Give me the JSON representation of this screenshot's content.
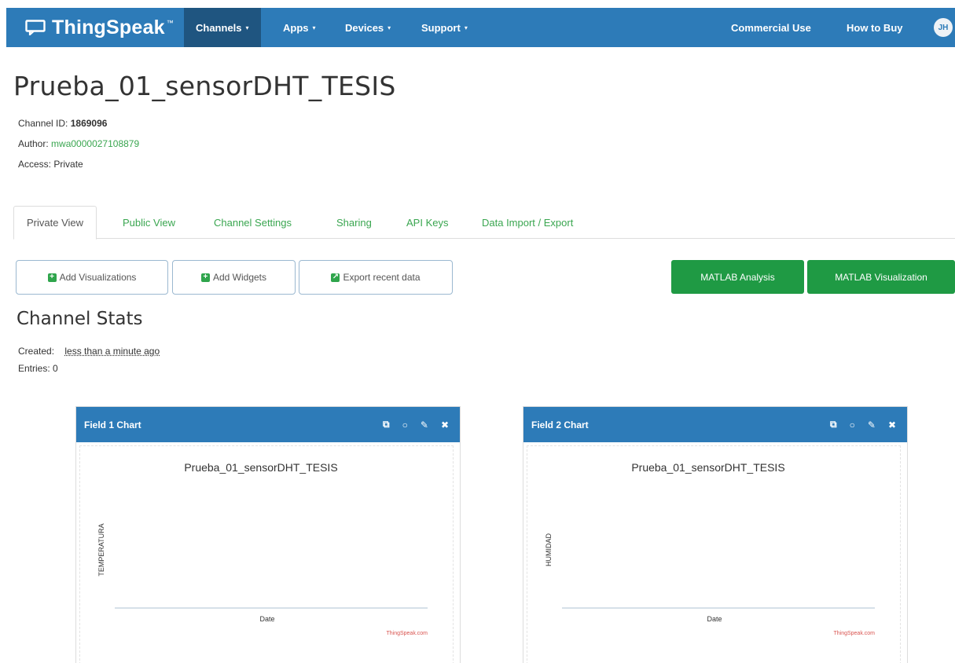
{
  "nav": {
    "brand": "ThingSpeak",
    "trademark": "™",
    "items": [
      {
        "label": "Channels",
        "caret": "▾"
      },
      {
        "label": "Apps",
        "caret": "▾"
      },
      {
        "label": "Devices",
        "caret": "▾"
      },
      {
        "label": "Support",
        "caret": "▾"
      }
    ],
    "right_items": [
      "Commercial Use",
      "How to Buy"
    ],
    "avatar_initials": "JH"
  },
  "channel": {
    "title": "Prueba_01_sensorDHT_TESIS",
    "id_label": "Channel ID:",
    "id_value": "1869096",
    "author_label": "Author:",
    "author_value": "mwa0000027108879",
    "access_label": "Access:",
    "access_value": "Private"
  },
  "tabs": [
    "Private View",
    "Public View",
    "Channel Settings",
    "Sharing",
    "API Keys",
    "Data Import / Export"
  ],
  "buttons": {
    "add_visualizations": "Add Visualizations",
    "add_widgets": "Add Widgets",
    "export_recent": "Export recent data",
    "matlab_analysis": "MATLAB Analysis",
    "matlab_visualization": "MATLAB Visualization"
  },
  "stats": {
    "title": "Channel Stats",
    "created_label": "Created:",
    "created_value": "less than a minute ago",
    "entries_label": "Entries:",
    "entries_value": "0"
  },
  "colors": {
    "nav_bg": "#2d7bb8",
    "active_nav": "#1f5580",
    "link_green": "#3aa650",
    "button_green": "#1f9a44",
    "credit_red": "#d9534f"
  },
  "panels": [
    {
      "header": "Field 1 Chart",
      "icons": [
        "external-link-icon",
        "comment-icon",
        "pencil-icon",
        "close-icon"
      ]
    },
    {
      "header": "Field 2 Chart",
      "icons": [
        "external-link-icon",
        "comment-icon",
        "pencil-icon",
        "close-icon"
      ]
    }
  ],
  "chart_data": [
    {
      "type": "line",
      "title": "Prueba_01_sensorDHT_TESIS",
      "xlabel": "Date",
      "ylabel": "TEMPERATURA",
      "series": [],
      "credit": "ThingSpeak.com"
    },
    {
      "type": "line",
      "title": "Prueba_01_sensorDHT_TESIS",
      "xlabel": "Date",
      "ylabel": "HUMIDAD",
      "series": [],
      "credit": "ThingSpeak.com"
    }
  ]
}
